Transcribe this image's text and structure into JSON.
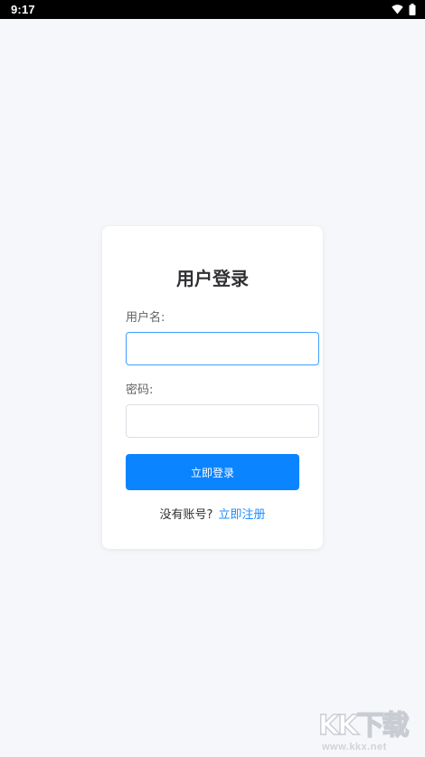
{
  "status_bar": {
    "time": "9:17",
    "icons": [
      "wifi-icon",
      "battery-icon"
    ]
  },
  "login": {
    "title": "用户登录",
    "username_label": "用户名:",
    "username_value": "",
    "password_label": "密码:",
    "password_value": "",
    "submit_label": "立即登录",
    "no_account_text": "没有账号?",
    "register_link": "立即注册"
  },
  "watermark": {
    "logo_text": "KK下载",
    "url": "www.kkx.net"
  },
  "colors": {
    "background": "#f5f7fa",
    "primary": "#0a84ff",
    "link": "#1a8cff",
    "focus_border": "#409eff"
  }
}
